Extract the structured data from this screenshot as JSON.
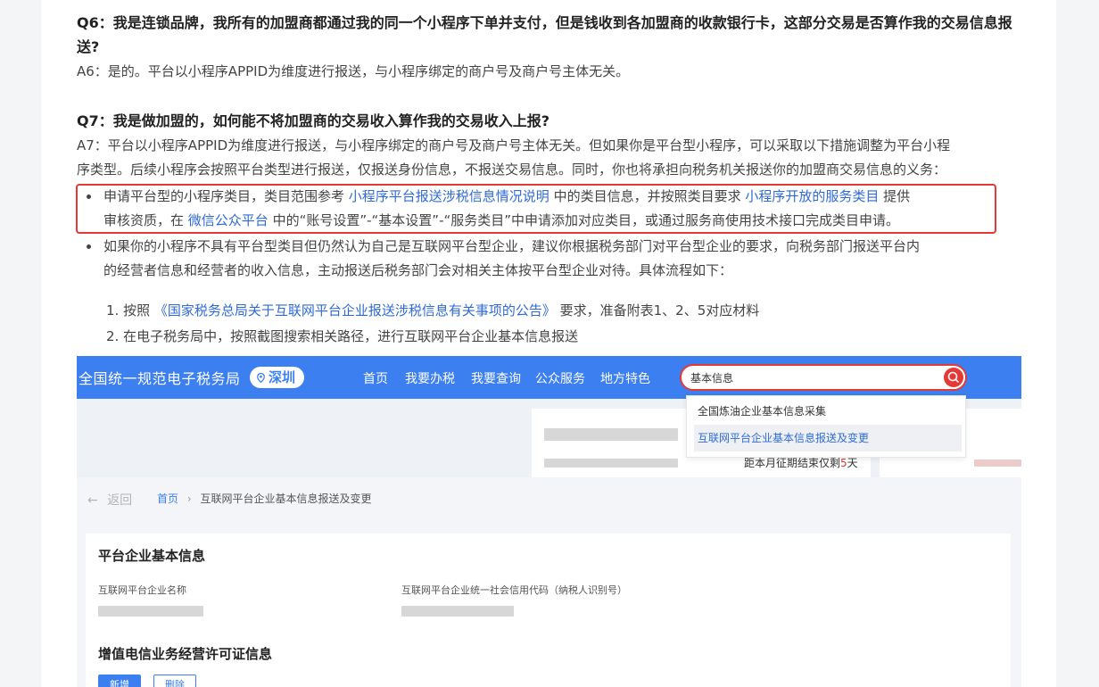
{
  "q6": {
    "question_line1": "Q6：我是连锁品牌，我所有的加盟商都通过我的同一个小程序下单并支付，但是钱收到各加盟商的收款银行卡，这部分交易是否算作我的交易信息报",
    "question_line2": "送?",
    "answer": "A6：是的。平台以小程序APPID为维度进行报送，与小程序绑定的商户号及商户号主体无关。"
  },
  "q7": {
    "question": "Q7：我是做加盟的，如何能不将加盟商的交易收入算作我的交易收入上报?",
    "answer_line1": "A7：平台以小程序APPID为维度进行报送，与小程序绑定的商户号及商户号主体无关。但如果你是平台型小程序，可以采取以下措施调整为平台小程",
    "answer_line2": "序类型。后续小程序会按照平台类型进行报送，仅报送身份信息，不报送交易信息。同时，你也将承担向税务机关报送你的加盟商交易信息的义务："
  },
  "bullet1": {
    "t1": "申请平台型的小程序类目，类目范围参考 ",
    "link1": "小程序平台报送涉税信息情况说明",
    "t2": " 中的类目信息，并按照类目要求 ",
    "link2": "小程序开放的服务类目",
    "t3": " 提供",
    "t4": "审核资质，在 ",
    "link3": "微信公众平台",
    "t5": " 中的“账号设置”-“基本设置”-“服务类目”中申请添加对应类目，或通过服务商使用技术接口完成类目申请。"
  },
  "bullet2": {
    "line1": "如果你的小程序不具有平台型类目但仍然认为自己是互联网平台型企业，建议你根据税务部门对平台型企业的要求，向税务部门报送平台内",
    "line2": "的经营者信息和经营者的收入信息，主动报送后税务部门会对相关主体按平台型企业对待。具体流程如下："
  },
  "steps": {
    "s1_pre": "1. 按照 ",
    "s1_link": "《国家税务总局关于互联网平台企业报送涉税信息有关事项的公告》",
    "s1_post": " 要求，准备附表1、2、5对应材料",
    "s2": "2. 在电子税务局中，按照截图搜索相关路径，进行互联网平台企业基本信息报送"
  },
  "screenshot": {
    "site_title": "全国统一规范电子税务局",
    "city": "深圳",
    "nav": [
      "首页",
      "我要办税",
      "我要查询",
      "公众服务",
      "地方特色"
    ],
    "search_value": "基本信息",
    "suggestions": [
      "全国炼油企业基本信息采集",
      "互联网平台企业基本信息报送及变更"
    ],
    "deadline_pre": "距本月征期结束仅剩",
    "deadline_days": "5",
    "deadline_post": "天",
    "back_label": "返回",
    "crumb_home": "首页",
    "crumb_sep": "›",
    "crumb_current": "互联网平台企业基本信息报送及变更",
    "card_title": "平台企业基本信息",
    "field1_label": "互联网平台企业名称",
    "field2_label": "互联网平台企业统一社会信用代码（纳税人识别号）",
    "section2_title": "增值电信业务经营许可证信息",
    "btn_new": "新增",
    "btn_delete": "删除"
  },
  "colors": {
    "link": "#2f6bd6",
    "highlight_border": "#e53935",
    "topbar": "#3b7ff0"
  }
}
